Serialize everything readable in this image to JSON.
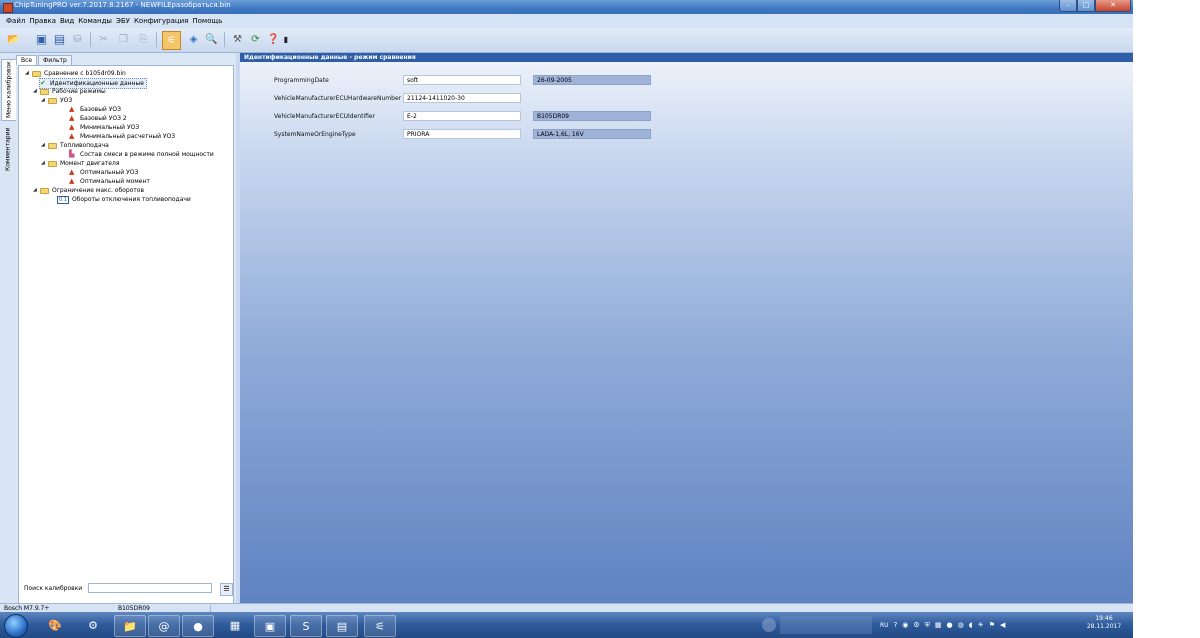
{
  "window": {
    "title": "ChipTuningPRO ver.7.2017.8.2167 - NEWFILEразобраться.bin",
    "buttons": {
      "minimize": "–",
      "maximize": "□",
      "close": "✕"
    }
  },
  "menu": [
    "Файл",
    "Правка",
    "Вид",
    "Команды",
    "ЭБУ",
    "Конфигурация",
    "Помощь"
  ],
  "side_tabs": [
    "Меню калибровок",
    "Комментарии"
  ],
  "panel_tabs": [
    "Все",
    "Фильтр"
  ],
  "tree": {
    "root": "Сравнение с b105dr09.bin",
    "id_data": "Идентификационные данные",
    "modes": "Рабочие режимы",
    "uoz": "УОЗ",
    "uoz_base": "Базовый УОЗ",
    "uoz_base2": "Базовый УОЗ 2",
    "uoz_min": "Минимальный УОЗ",
    "uoz_min_calc": "Минимальный расчетный УОЗ",
    "fuel": "Топливоподача",
    "fuel_mix": "Состав смеси в режиме полной мощности",
    "torque": "Момент двигателя",
    "torque_uoz": "Оптимальный УОЗ",
    "torque_opt": "Оптимальный момент",
    "rpm_limit": "Ограничение макс. оборотов",
    "rpm_cutoff": "Обороты отключения топливоподачи"
  },
  "search": {
    "label": "Поиск калибровки",
    "value": ""
  },
  "panel": {
    "title": "Идентификационные данные - режим сравнения",
    "fields": [
      {
        "label": "ProgrammingDate",
        "value": "soft",
        "compare": "26-09-2005"
      },
      {
        "label": "VehicleManufacturerECUHardwareNumber",
        "value": "21124-1411020-30",
        "compare": ""
      },
      {
        "label": "VehicleManufacturerECUIdentifier",
        "value": "E-2",
        "compare": "B105DR09"
      },
      {
        "label": "SystemNameOrEngineType",
        "value": "PRIORA",
        "compare": "LADA-1,6L, 16V"
      }
    ]
  },
  "status": {
    "ecu": "Bosch M7.9.7+",
    "firmware": "B105DR09"
  },
  "taskbar": {
    "lang": "RU",
    "time": "19:46",
    "date": "28.11.2017"
  }
}
